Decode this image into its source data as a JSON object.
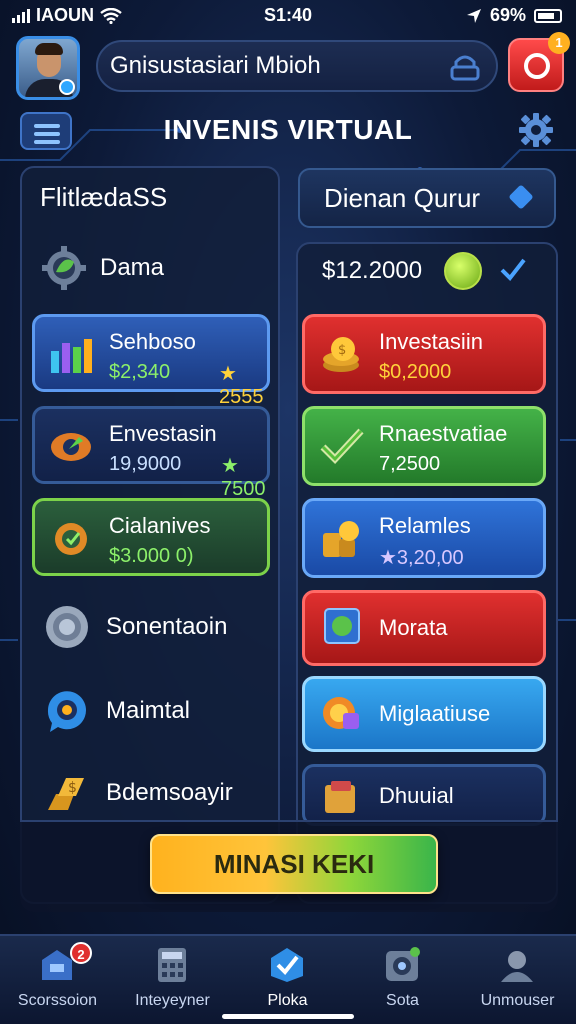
{
  "status_bar": {
    "carrier": "IAOUN",
    "time": "S1:40",
    "battery": "69%"
  },
  "header": {
    "player_name": "Gnisustasiari Mbioh",
    "alert_count": "1",
    "title": "INVENIS VIRTUAL"
  },
  "left_panel": {
    "title": "FlitlædaSS",
    "dama_label": "Dama",
    "cards": [
      {
        "name": "Sehboso",
        "value": "$2,340",
        "score": "★ 2555"
      },
      {
        "name": "Envestasin",
        "value": "19,9000",
        "score": "★ 7500"
      },
      {
        "name": "Cialanives",
        "value": "$3.000 0)",
        "score": ""
      }
    ],
    "items": [
      {
        "label": "Sonentaoin"
      },
      {
        "label": "Maimtal"
      },
      {
        "label": "Bdemsoayir"
      }
    ]
  },
  "right_panel": {
    "top_button": "Dienan Qurur",
    "balance": "$12.2000",
    "cards": [
      {
        "name": "Investasiin",
        "value": "$0,2000"
      },
      {
        "name": "Rnaestvatiae",
        "value": "7,2500"
      },
      {
        "name": "Relamles",
        "value": "★3,20,00"
      },
      {
        "name": "Morata",
        "value": ""
      },
      {
        "name": "Miglaatiuse",
        "value": ""
      },
      {
        "name": "Dhuuial",
        "value": ""
      }
    ]
  },
  "main_button": "MINASI KEKI",
  "tabs": [
    {
      "label": "Scorssoion",
      "badge": "2",
      "icon": "store-icon"
    },
    {
      "label": "Inteyeyner",
      "badge": "",
      "icon": "calculator-icon"
    },
    {
      "label": "Ploka",
      "badge": "",
      "icon": "check-badge-icon"
    },
    {
      "label": "Sota",
      "badge": "",
      "icon": "vault-icon"
    },
    {
      "label": "Unmouser",
      "badge": "",
      "icon": "profile-icon"
    }
  ]
}
